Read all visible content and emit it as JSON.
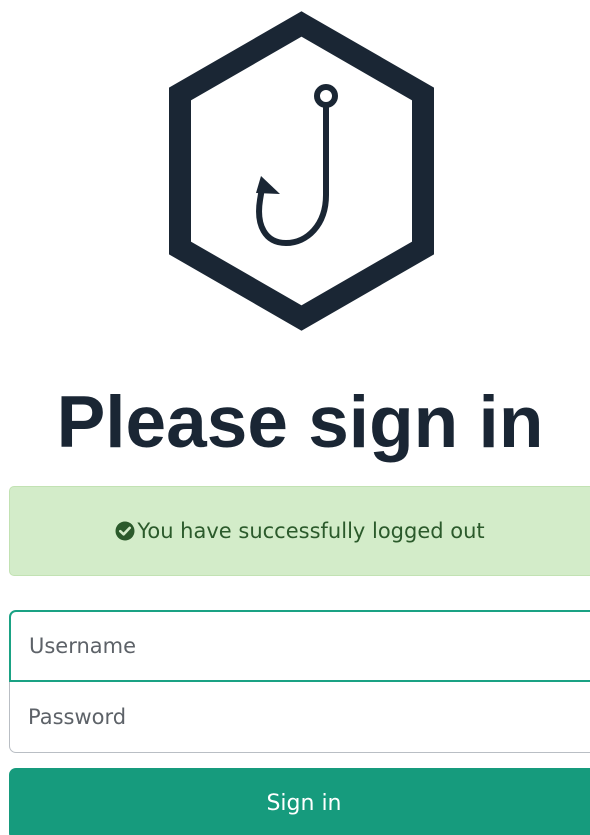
{
  "logo": {
    "icon": "fishhook-hexagon-logo",
    "color": "#1a2634"
  },
  "heading": "Please sign in",
  "alert": {
    "icon": "check-circle-icon",
    "message": "You have successfully logged out",
    "text_color": "#2b5a2b",
    "background": "#d3ecc9"
  },
  "form": {
    "username_placeholder": "Username",
    "password_placeholder": "Password",
    "submit_label": "Sign in",
    "accent": "#169b7d"
  }
}
